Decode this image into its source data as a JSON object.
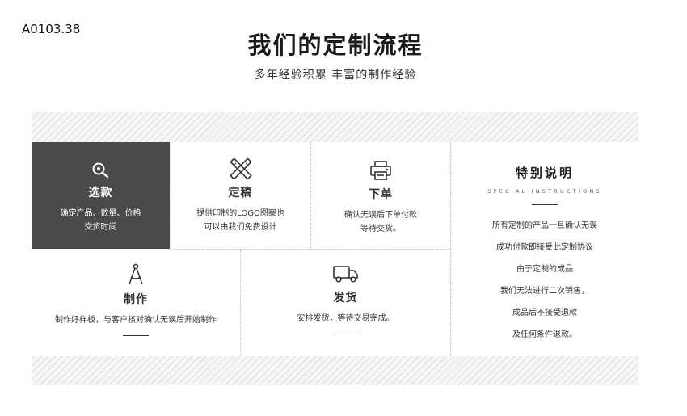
{
  "code": "A0103.38",
  "title": "我们的定制流程",
  "subtitle": "多年经验积累 丰富的制作经验",
  "steps": [
    {
      "name": "选款",
      "desc_lines": [
        "确定产品、数量、价格",
        "交货时间"
      ],
      "icon": "search-icon"
    },
    {
      "name": "定稿",
      "desc_lines": [
        "提供印制的LOGO图案也",
        "可以由我们免费设计"
      ],
      "icon": "pencil-ruler-icon"
    },
    {
      "name": "下单",
      "desc_lines": [
        "确认无误后下单付款",
        "等待交货。"
      ],
      "icon": "printer-icon"
    },
    {
      "name": "制作",
      "desc_lines": [
        "制作好样板，与客户核对确认无误后开始制作"
      ],
      "icon": "compass-icon"
    },
    {
      "name": "发货",
      "desc_lines": [
        "安排发货，等待交易完成。"
      ],
      "icon": "truck-icon"
    }
  ],
  "special": {
    "title": "特别说明",
    "subtitle": "SPECIAL INSTRUCTIONS",
    "items": [
      "所有定制的产品一旦确认无误",
      "成功付款即接受此定制协议",
      "由于定制的成品",
      "我们无法进行二次销售，",
      "成品后不接受退款",
      "及任何条件退款。"
    ]
  },
  "colors": {
    "dark_card": "#4a4a4a",
    "text": "#333333"
  }
}
